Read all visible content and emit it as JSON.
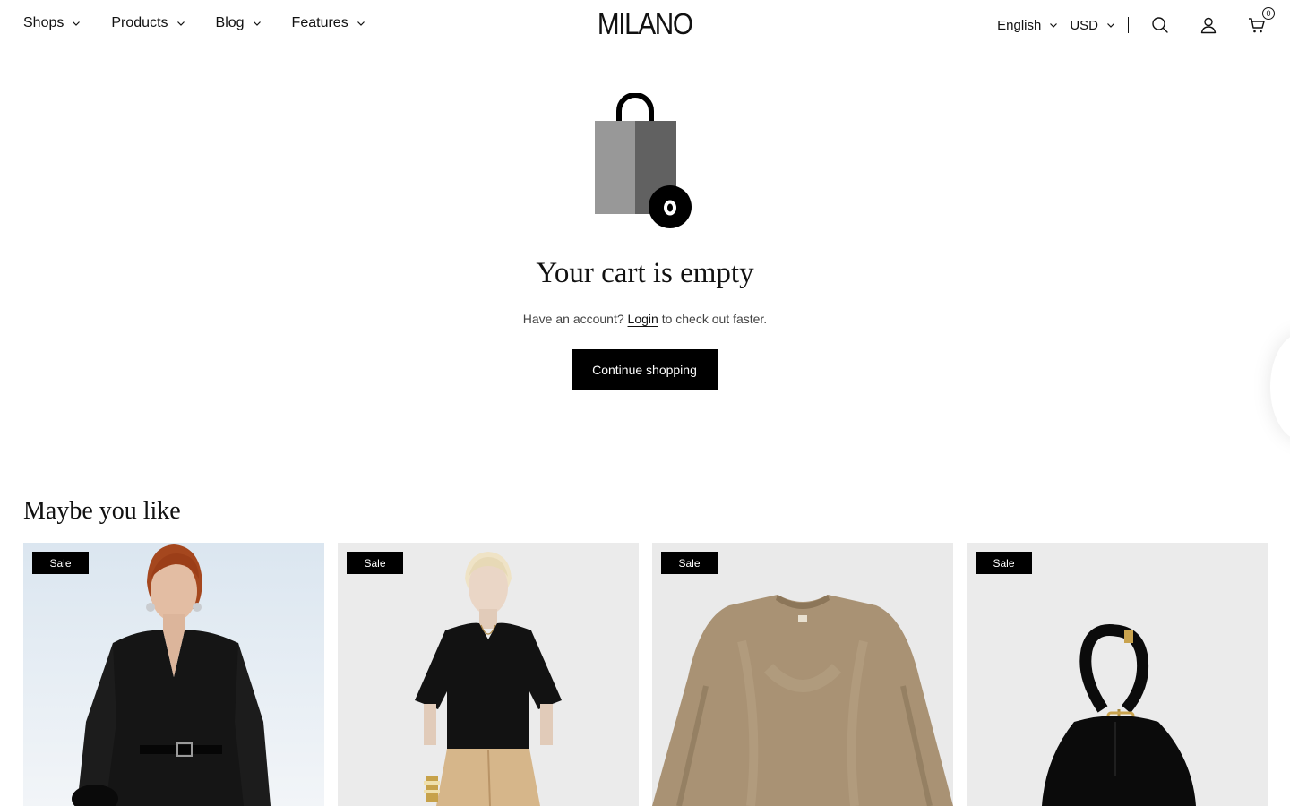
{
  "header": {
    "nav": [
      {
        "label": "Shops"
      },
      {
        "label": "Products"
      },
      {
        "label": "Blog"
      },
      {
        "label": "Features"
      }
    ],
    "logo": "MILANO",
    "language": "English",
    "currency": "USD",
    "cart_count": "0",
    "icons": [
      "search-icon",
      "account-icon",
      "cart-icon"
    ]
  },
  "empty_cart": {
    "title": "Your cart is empty",
    "subtitle_before": "Have an account?",
    "login_link": "Login",
    "subtitle_after": "to check out faster.",
    "button": "Continue shopping"
  },
  "recommendations": {
    "title": "Maybe you like",
    "products": [
      {
        "badge": "Sale",
        "image": "woman-black-blazer-belt"
      },
      {
        "badge": "Sale",
        "image": "woman-black-tee-beige-trousers"
      },
      {
        "badge": "Sale",
        "image": "beige-fluffy-sweater"
      },
      {
        "badge": "Sale",
        "image": "black-leather-hobo-bag"
      }
    ]
  },
  "colors": {
    "primary": "#000000",
    "background": "#ffffff",
    "bag_light": "#989898",
    "bag_dark": "#616161"
  }
}
